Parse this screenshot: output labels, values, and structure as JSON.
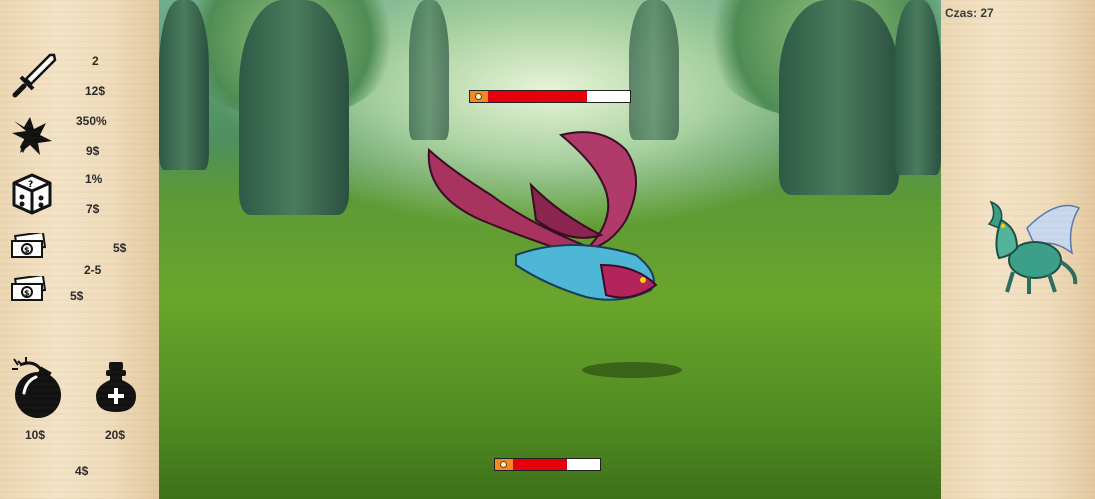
{
  "shop": {
    "sword": {
      "icon": "sword-icon",
      "level": "2",
      "price": "12$"
    },
    "crit": {
      "icon": "critical-hit-icon",
      "value": "350%",
      "price": "9$"
    },
    "luck": {
      "icon": "dice-icon",
      "value": "1%",
      "price": "7$"
    },
    "money1": {
      "icon": "money-icon",
      "price": "5$"
    },
    "money2": {
      "icon": "money-icon",
      "range": "2-5",
      "price": "5$"
    },
    "bomb": {
      "icon": "bomb-icon",
      "price": "10$"
    },
    "potion": {
      "icon": "health-potion-icon",
      "price": "20$"
    },
    "extra_price": "4$"
  },
  "hud": {
    "timer": "Czas: 27"
  },
  "enemy": {
    "name_icon": "bat-dragon-enemy",
    "hp_fraction": 0.7
  },
  "player": {
    "hp_fraction": 0.62
  },
  "next_enemy": {
    "icon": "green-dragon-icon"
  },
  "colors": {
    "hp_fill": "#e5000c",
    "hp_badge": "#f08a24",
    "panel": "#efdcbc"
  }
}
